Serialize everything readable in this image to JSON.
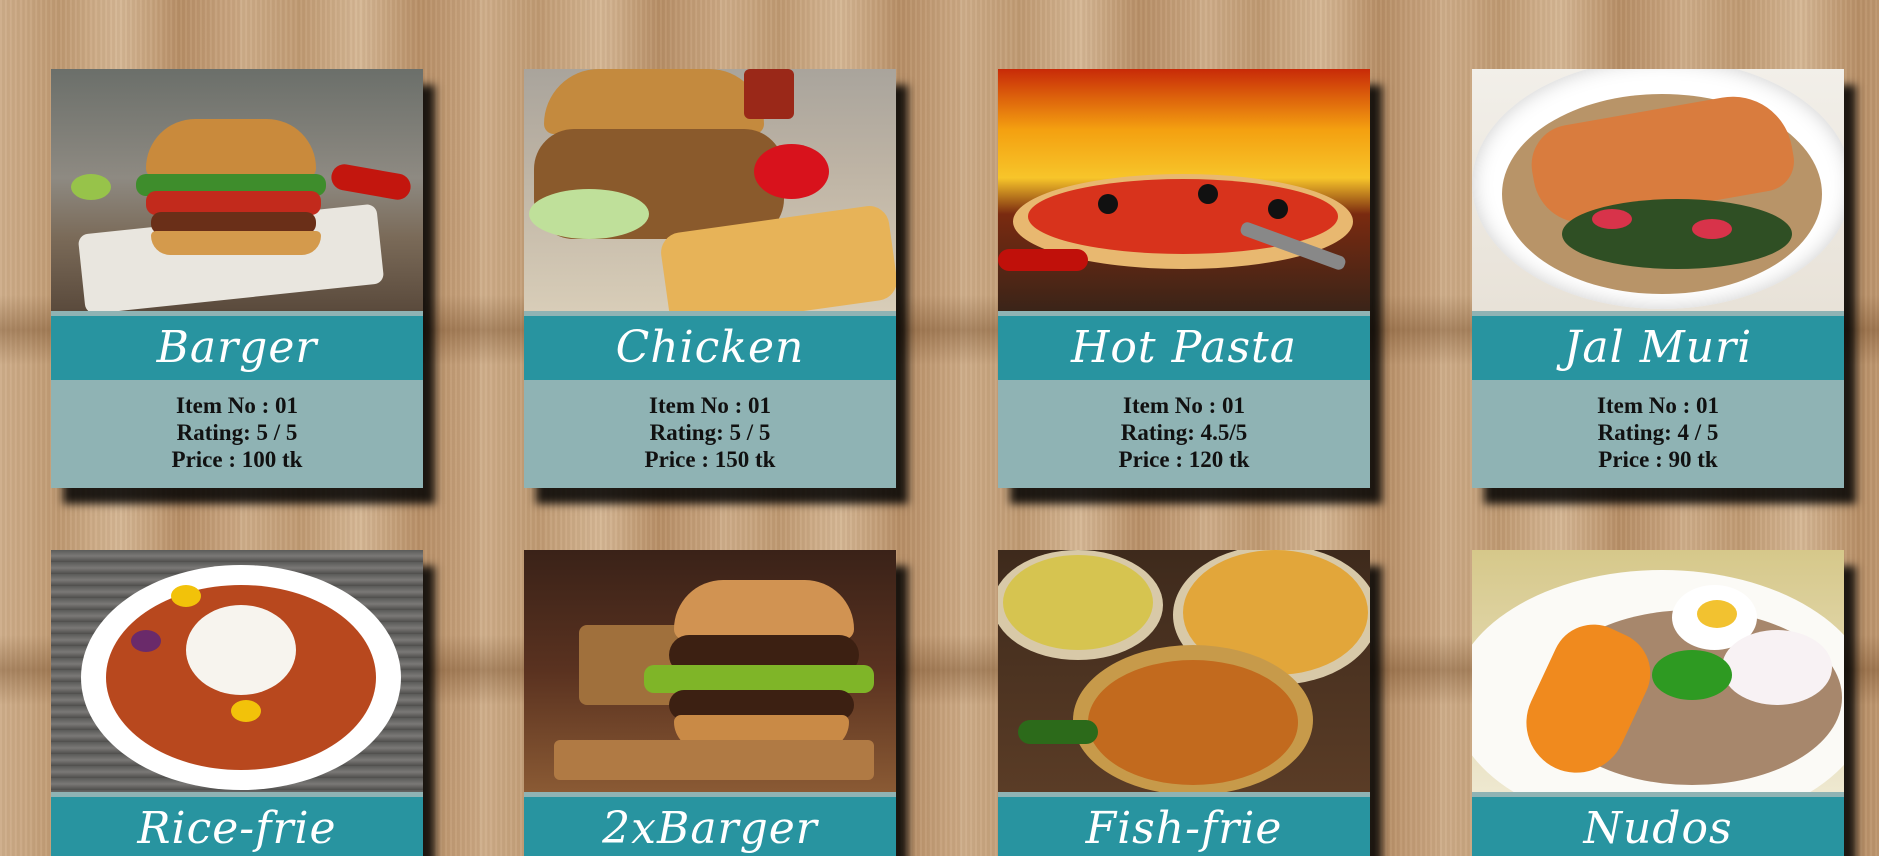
{
  "cards": [
    {
      "title": "Barger",
      "item_no": "Item No : 01",
      "rating": "Rating: 5 / 5",
      "price": "Price : 100 tk",
      "image": "burger-photo"
    },
    {
      "title": "Chicken",
      "item_no": "Item No : 01",
      "rating": "Rating: 5 / 5",
      "price": "Price : 150 tk",
      "image": "chicken-burger-fries-photo"
    },
    {
      "title": "Hot Pasta",
      "item_no": "Item No : 01",
      "rating": "Rating: 4.5/5",
      "price": "Price : 120 tk",
      "image": "pizza-fire-photo"
    },
    {
      "title": "Jal Muri",
      "item_no": "Item No : 01",
      "rating": "Rating: 4 / 5",
      "price": "Price : 90 tk",
      "image": "salmon-bowl-photo"
    },
    {
      "title": "Rice-frie",
      "image": "rice-chicken-plate-photo"
    },
    {
      "title": "2xBarger",
      "image": "double-burger-photo"
    },
    {
      "title": "Fish-frie",
      "image": "curry-bowls-photo"
    },
    {
      "title": "Nudos",
      "image": "noodle-bowl-photo"
    }
  ],
  "colors": {
    "title_bar": "#2894a0",
    "info_panel": "#8fb3b4",
    "background_wood": "#c09a72"
  }
}
